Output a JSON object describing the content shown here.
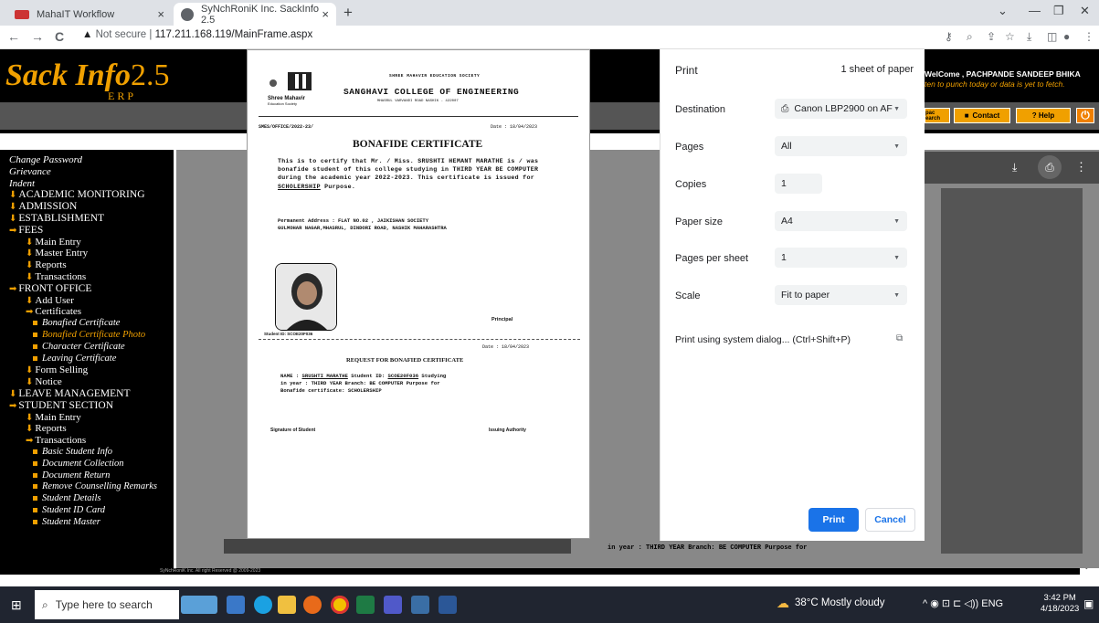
{
  "browser": {
    "tabs": [
      {
        "title": "MahaIT Workflow",
        "close": "×"
      },
      {
        "title": "SyNchRoniK Inc. SackInfo 2.5",
        "close": "×"
      }
    ],
    "new_tab": "+",
    "nav": {
      "back": "←",
      "forward": "→",
      "reload": "C"
    },
    "url_security": "Not secure",
    "url": "117.211.168.119/MainFrame.aspx",
    "window_controls": {
      "dropdown": "⌄",
      "minimize": "—",
      "restore": "❐",
      "close": "✕"
    }
  },
  "sackinfo": {
    "logo_word": "Sack Info",
    "logo_version": "2.5",
    "erp": "ERP",
    "welcome": "WelCome , PACHPANDE SANDEEP BHIKA",
    "warning": "ten to punch today or data is yet to fetch.",
    "buttons": {
      "opac": "pac earch",
      "contact": "Contact",
      "help": "? Help"
    },
    "copyright": "SyNchRoniK Inc. All right Reserved @ 2009-2023"
  },
  "sidebar": [
    {
      "level": "l0",
      "label": "Change Password",
      "marker": ""
    },
    {
      "level": "l0",
      "label": "Grievance",
      "marker": ""
    },
    {
      "level": "l0",
      "label": "Indent",
      "marker": ""
    },
    {
      "level": "l1",
      "label": "ACADEMIC MONITORING",
      "marker": "down"
    },
    {
      "level": "l1",
      "label": "ADMISSION",
      "marker": "down"
    },
    {
      "level": "l1",
      "label": "ESTABLISHMENT",
      "marker": "down"
    },
    {
      "level": "l1",
      "label": "FEES",
      "marker": "right"
    },
    {
      "level": "l2",
      "label": "Main Entry",
      "marker": "down"
    },
    {
      "level": "l2",
      "label": "Master Entry",
      "marker": "down"
    },
    {
      "level": "l2",
      "label": "Reports",
      "marker": "down"
    },
    {
      "level": "l2",
      "label": "Transactions",
      "marker": "down"
    },
    {
      "level": "l1",
      "label": "FRONT OFFICE",
      "marker": "right"
    },
    {
      "level": "l2",
      "label": "Add User",
      "marker": "down"
    },
    {
      "level": "l2",
      "label": "Certificates",
      "marker": "right"
    },
    {
      "level": "l3",
      "label": "Bonafied Certificate",
      "marker": "square"
    },
    {
      "level": "l3",
      "label": "Bonafied Certificate Photo",
      "marker": "square",
      "active": true
    },
    {
      "level": "l3",
      "label": "Character Certificate",
      "marker": "square"
    },
    {
      "level": "l3",
      "label": "Leaving Certificate",
      "marker": "square"
    },
    {
      "level": "l2",
      "label": "Form Selling",
      "marker": "down"
    },
    {
      "level": "l2",
      "label": "Notice",
      "marker": "down"
    },
    {
      "level": "l1",
      "label": "LEAVE MANAGEMENT",
      "marker": "down"
    },
    {
      "level": "l1",
      "label": "STUDENT SECTION",
      "marker": "right"
    },
    {
      "level": "l2",
      "label": "Main Entry",
      "marker": "down"
    },
    {
      "level": "l2",
      "label": "Reports",
      "marker": "down"
    },
    {
      "level": "l2",
      "label": "Transactions",
      "marker": "right"
    },
    {
      "level": "l3",
      "label": "Basic Student Info",
      "marker": "square"
    },
    {
      "level": "l3",
      "label": "Document Collection",
      "marker": "square"
    },
    {
      "level": "l3",
      "label": "Document Return",
      "marker": "square"
    },
    {
      "level": "l3",
      "label": "Remove Counselling Remarks",
      "marker": "square"
    },
    {
      "level": "l3",
      "label": "Student Details",
      "marker": "square"
    },
    {
      "level": "l3",
      "label": "Student ID Card",
      "marker": "square"
    },
    {
      "level": "l3",
      "label": "Student Master",
      "marker": "square"
    }
  ],
  "certificate": {
    "society": "SHREE MAHAVIR EDUCATION SOCIETY",
    "college": "SANGHAVI COLLEGE OF ENGINEERING",
    "address": "MHASRUL VARVANDI ROAD NASHIK - 422007",
    "logo_text_1": "Shree Mahavir",
    "logo_text_2": "Education Society",
    "ref_no": "SMES/OFFICE/2022-23/",
    "date": "Date : 18/04/2023",
    "heading": "BONAFIDE CERTIFICATE",
    "body_1": "This is to certify that Mr. / Miss. SRUSHTI HEMANT MARATHE is / was bonafide student of this college studying in THIRD YEAR BE COMPUTER during the academic year 2022-2023. This certificate is issued for ",
    "body_purpose": "SCHOLERSHIP",
    "body_2": " Purpose.",
    "perm_address_1": "Permanent Address : FLAT NO.02 , JAIKISHAN SOCIETY",
    "perm_address_2": "GULMOHAR NAGAR,MHASRUL, DINDORI ROAD, NASHIK MAHARASHTRA",
    "principal": "Principal",
    "student_id_label": "Student ID: SCOE20F036",
    "date2": "Date : 18/04/2023",
    "request_heading": "REQUEST FOR BONAFIED CERTIFICATE",
    "req_name_label": "NAME : ",
    "req_name": "SRUSHTI MARATHE",
    "req_id_label": " Student ID: ",
    "req_id": "SCOE20F036",
    "req_rest_1": " Studying",
    "req_line2": "in year : THIRD YEAR Branch: BE COMPUTER Purpose for",
    "req_line3": "Bonafide certificate: SCHOLERSHIP",
    "sig_student": "Signature of Student",
    "sig_authority": "Issuing Authority"
  },
  "viewer_bg_text": "in year : THIRD YEAR Branch: BE COMPUTER Purpose for",
  "print_dialog": {
    "title": "Print",
    "sheets": "1 sheet of paper",
    "rows": [
      {
        "label": "Destination",
        "value": "Canon LBP2900 on AF",
        "type": "select",
        "icon": "printer"
      },
      {
        "label": "Pages",
        "value": "All",
        "type": "select"
      },
      {
        "label": "Copies",
        "value": "1",
        "type": "input"
      },
      {
        "label": "Paper size",
        "value": "A4",
        "type": "select"
      },
      {
        "label": "Pages per sheet",
        "value": "1",
        "type": "select"
      },
      {
        "label": "Scale",
        "value": "Fit to paper",
        "type": "select"
      }
    ],
    "system_dialog": "Print using system dialog... (Ctrl+Shift+P)",
    "print_button": "Print",
    "cancel_button": "Cancel"
  },
  "taskbar": {
    "search_placeholder": "Type here to search",
    "weather": "38°C  Mostly cloudy",
    "lang": "ENG",
    "time": "3:42 PM",
    "date": "4/18/2023"
  }
}
